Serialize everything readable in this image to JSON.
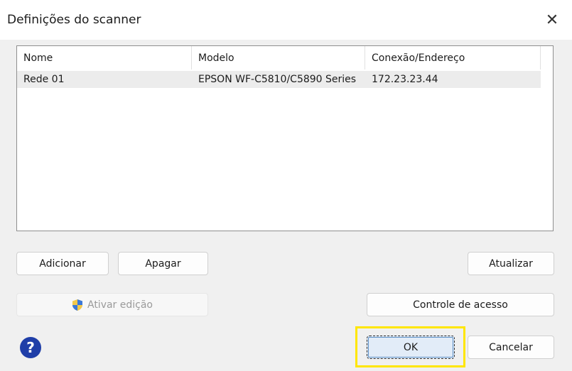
{
  "window": {
    "title": "Definições do scanner",
    "close_glyph": "✕"
  },
  "list": {
    "columns": [
      "Nome",
      "Modelo",
      "Conexão/Endereço"
    ],
    "rows": [
      {
        "nome": "Rede 01",
        "modelo": "EPSON WF-C5810/C5890 Series",
        "endereco": "172.23.23.44"
      }
    ]
  },
  "buttons": {
    "adicionar": "Adicionar",
    "apagar": "Apagar",
    "atualizar": "Atualizar",
    "ativar_edicao": "Ativar edição",
    "controle_acesso": "Controle de acesso",
    "ok": "OK",
    "cancelar": "Cancelar"
  },
  "help": {
    "glyph": "?"
  },
  "icons": {
    "shield": "uac-shield-icon",
    "help": "help-icon",
    "close": "close-icon"
  },
  "colors": {
    "highlight": "#ffe600",
    "help_bg": "#1f3ea8"
  }
}
